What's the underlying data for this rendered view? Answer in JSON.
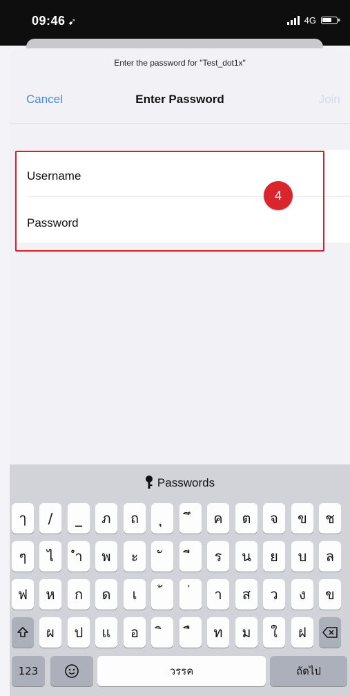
{
  "status": {
    "time": "09:46",
    "location_icon": "location-arrow-icon",
    "network": "4G"
  },
  "sheet": {
    "prompt": "Enter the password for \"Test_dot1x\"",
    "cancel": "Cancel",
    "title": "Enter Password",
    "join": "Join"
  },
  "form": {
    "username_label": "Username",
    "password_label": "Password"
  },
  "annotation": {
    "step": "4",
    "color": "#d3202a"
  },
  "keyboard": {
    "suggestion": "Passwords",
    "rows": [
      [
        "ๅ",
        "/",
        "_",
        "ภ",
        "ถ",
        "ุ",
        "ึ",
        "ค",
        "ต",
        "จ",
        "ข",
        "ช"
      ],
      [
        "ๆ",
        "ไ",
        "ำ",
        "พ",
        "ะ",
        "ั",
        "ี",
        "ร",
        "น",
        "ย",
        "บ",
        "ล"
      ],
      [
        "ฟ",
        "ห",
        "ก",
        "ด",
        "เ",
        "้",
        "่",
        "า",
        "ส",
        "ว",
        "ง",
        "ข"
      ],
      [
        "ผ",
        "ป",
        "แ",
        "อ",
        "ิ",
        "ื",
        "ท",
        "ม",
        "ใ",
        "ฝ"
      ]
    ],
    "numbers_key": "123",
    "space_label": "วรรค",
    "return_label": "ถัดไป"
  },
  "colors": {
    "accent": "#3e8ce8",
    "join_disabled": "#cfdaf0",
    "highlight": "#d3202a"
  }
}
